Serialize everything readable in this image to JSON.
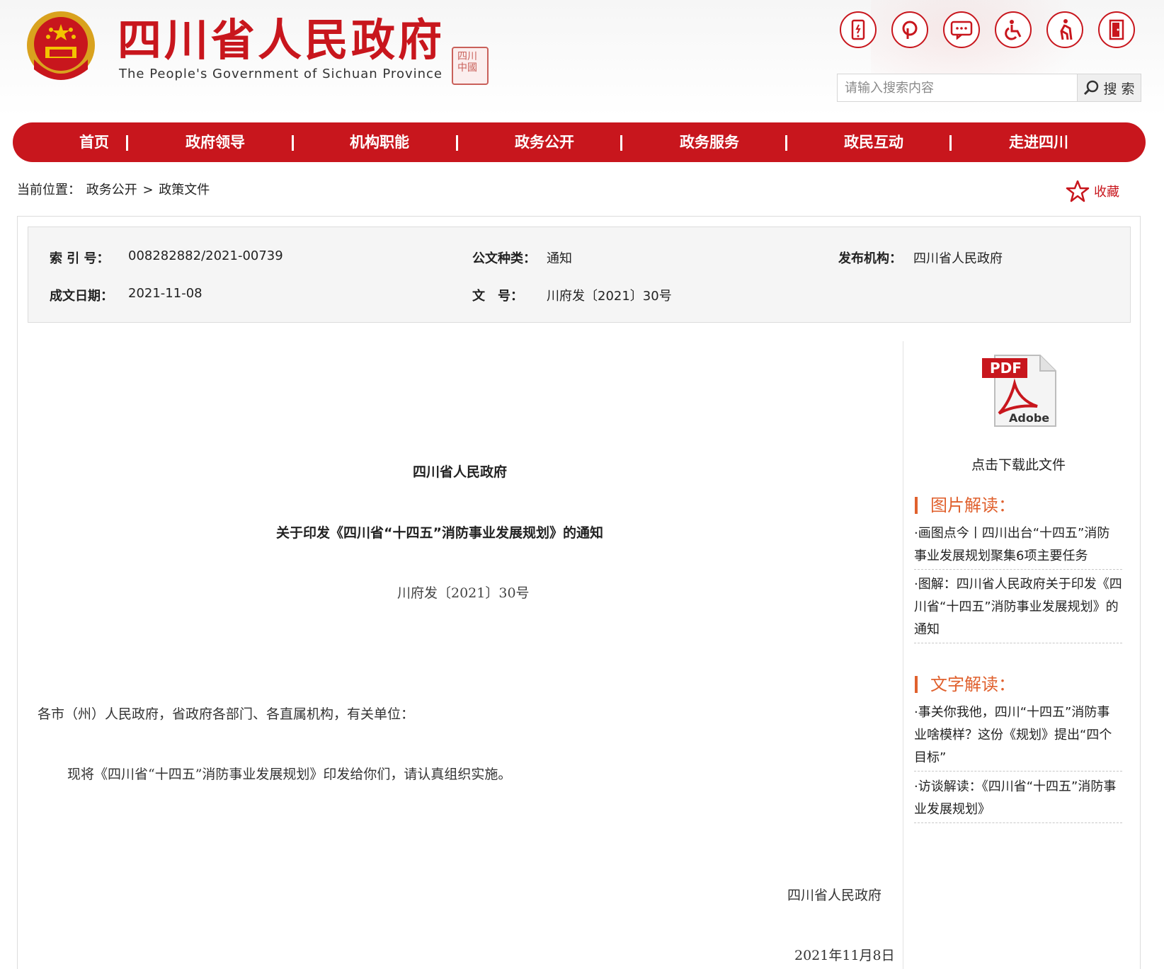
{
  "header": {
    "title": "四川省人民政府",
    "subtitle": "The People's Government of Sichuan Province",
    "seal_text": "四川中國",
    "tools": [
      "mobile-icon",
      "weibo-icon",
      "message-icon",
      "accessibility-icon",
      "elderly-icon",
      "login-icon"
    ],
    "search_placeholder": "请输入搜索内容",
    "search_label": "搜 索"
  },
  "nav": {
    "items": [
      "首页",
      "政府领导",
      "机构职能",
      "政务公开",
      "政务服务",
      "政民互动",
      "走进四川"
    ]
  },
  "breadcrumb": {
    "prefix": "当前位置：",
    "level1": "政务公开",
    "separator": ">",
    "level2": "政策文件"
  },
  "favorite_label": "收藏",
  "meta": {
    "index_label": "索 引 号：",
    "index_value": "008282882/2021-00739",
    "type_label": "公文种类：",
    "type_value": "通知",
    "issuer_label": "发布机构：",
    "issuer_value": "四川省人民政府",
    "date_label": "成文日期：",
    "date_value": "2021-11-08",
    "docno_label": "文　号：",
    "docno_value": "川府发〔2021〕30号"
  },
  "doc": {
    "issuer_heading": "四川省人民政府",
    "title": "关于印发《四川省“十四五”消防事业发展规划》的通知",
    "number": "川府发〔2021〕30号",
    "salutation": "各市（州）人民政府，省政府各部门、各直属机构，有关单位：",
    "body": "现将《四川省“十四五”消防事业发展规划》印发给你们，请认真组织实施。",
    "signature": "四川省人民政府",
    "date": "2021年11月8日"
  },
  "sidebar": {
    "download_text": "点击下载此文件",
    "pdf_label": "PDF",
    "adobe_label": "Adobe",
    "image_section_title": "图片解读：",
    "image_links": [
      "·画图点今丨四川出台“十四五”消防事业发展规划聚集6项主要任务",
      "·图解：四川省人民政府关于印发《四川省“十四五”消防事业发展规划》的通知"
    ],
    "text_section_title": "文字解读：",
    "text_links": [
      "·事关你我他，四川“十四五”消防事业啥模样？这份《规划》提出“四个目标”",
      "·访谈解读：《四川省“十四五”消防事业发展规划》"
    ]
  },
  "colors": {
    "brand_red": "#c8161d",
    "section_orange": "#e0612e"
  }
}
